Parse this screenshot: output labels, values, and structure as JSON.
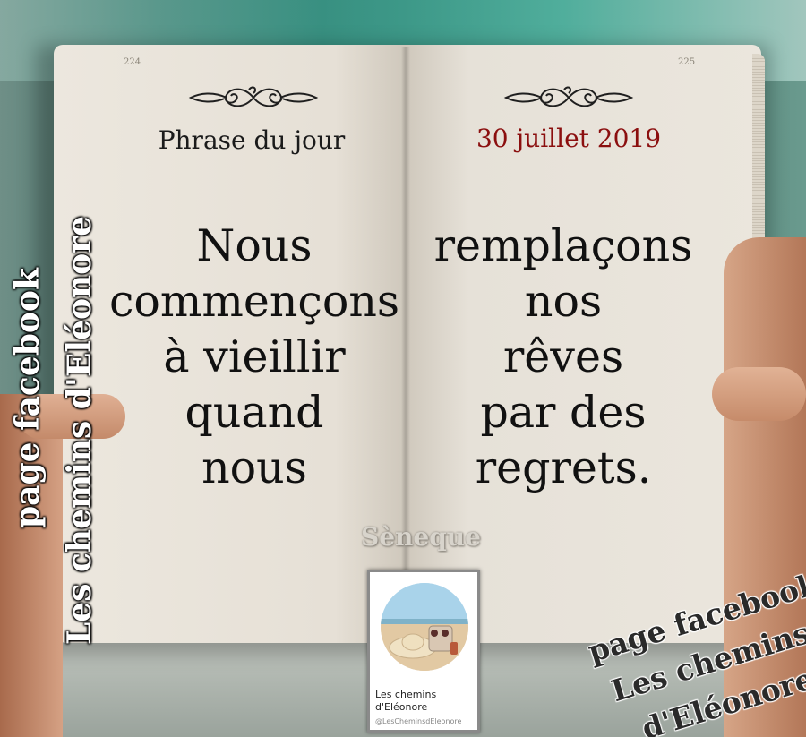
{
  "book": {
    "page_left_number": "224",
    "page_right_number": "225",
    "header_left": "Phrase du jour",
    "header_right": "30 juillet 2019",
    "quote_left_lines": [
      "Nous",
      "commençons",
      "à vieillir",
      "quand",
      "nous"
    ],
    "quote_right_lines": [
      "remplaçons",
      "nos",
      "rêves",
      "par des",
      "regrets."
    ],
    "author": "Sèneque"
  },
  "watermark_left": {
    "line1": "page facebook",
    "line2": "Les chemins d'Eléonore"
  },
  "watermark_right": {
    "line1": "page facebook",
    "line2": "Les chemins",
    "line3": "d'Eléonore"
  },
  "facebook_card": {
    "name_line1": "Les chemins",
    "name_line2": "d'Eléonore",
    "handle": "@LesCheminsdEleonore"
  },
  "colors": {
    "page": "#e6e0d6",
    "date_red": "#8b0f0f",
    "ink": "#111111"
  }
}
